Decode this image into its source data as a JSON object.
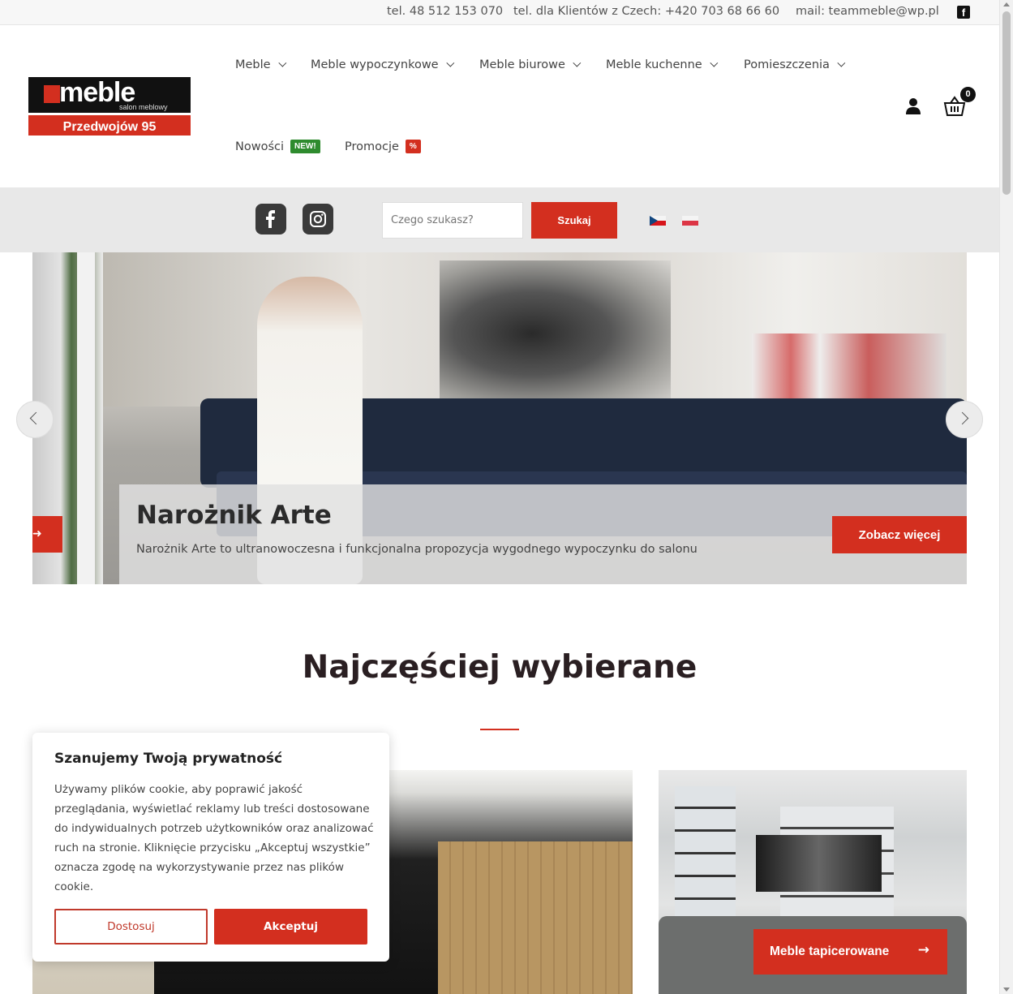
{
  "topbar": {
    "phone": "tel. 48 512 153 070",
    "phone_cz": "tel. dla Klientów z Czech: +420 703 68 66 60",
    "email": "mail: teammeble@wp.pl",
    "facebook_icon": "facebook-icon"
  },
  "logo": {
    "word": "meble",
    "sub": "salon meblowy",
    "address": "Przedwojów 95"
  },
  "nav": {
    "items": [
      {
        "label": "Meble"
      },
      {
        "label": "Meble wypoczynkowe"
      },
      {
        "label": "Meble biurowe"
      },
      {
        "label": "Meble kuchenne"
      },
      {
        "label": "Pomieszczenia"
      },
      {
        "label": "Nowości",
        "badge": "NEW!",
        "badge_color": "#2e8b2e"
      },
      {
        "label": "Promocje",
        "badge": "%",
        "badge_color": "#d32f1f"
      }
    ],
    "cart_count": "0"
  },
  "search": {
    "placeholder": "Czego szukasz?",
    "button": "Szukaj"
  },
  "slider": {
    "title": "Narożnik Arte",
    "text": "Narożnik Arte to ultranowoczesna i  funkcjonalna propozycja wygodnego wypoczynku do salonu",
    "button": "Zobacz więcej"
  },
  "section": {
    "title": "Najczęściej wybierane"
  },
  "tiles": {
    "button": "Meble tapicerowane",
    "arrow": "→"
  },
  "cookie": {
    "title": "Szanujemy Twoją prywatność",
    "text": "Używamy plików cookie, aby poprawić jakość przeglądania, wyświetlać reklamy lub treści dostosowane do indywidualnych potrzeb użytkowników oraz analizować ruch na stronie. Kliknięcie przycisku „Akceptuj wszystkie” oznacza zgodę na wykorzystywanie przez nas plików cookie.",
    "customize": "Dostosuj",
    "accept": "Akceptuj"
  },
  "colors": {
    "accent": "#d32f1f",
    "dark": "#111111"
  }
}
